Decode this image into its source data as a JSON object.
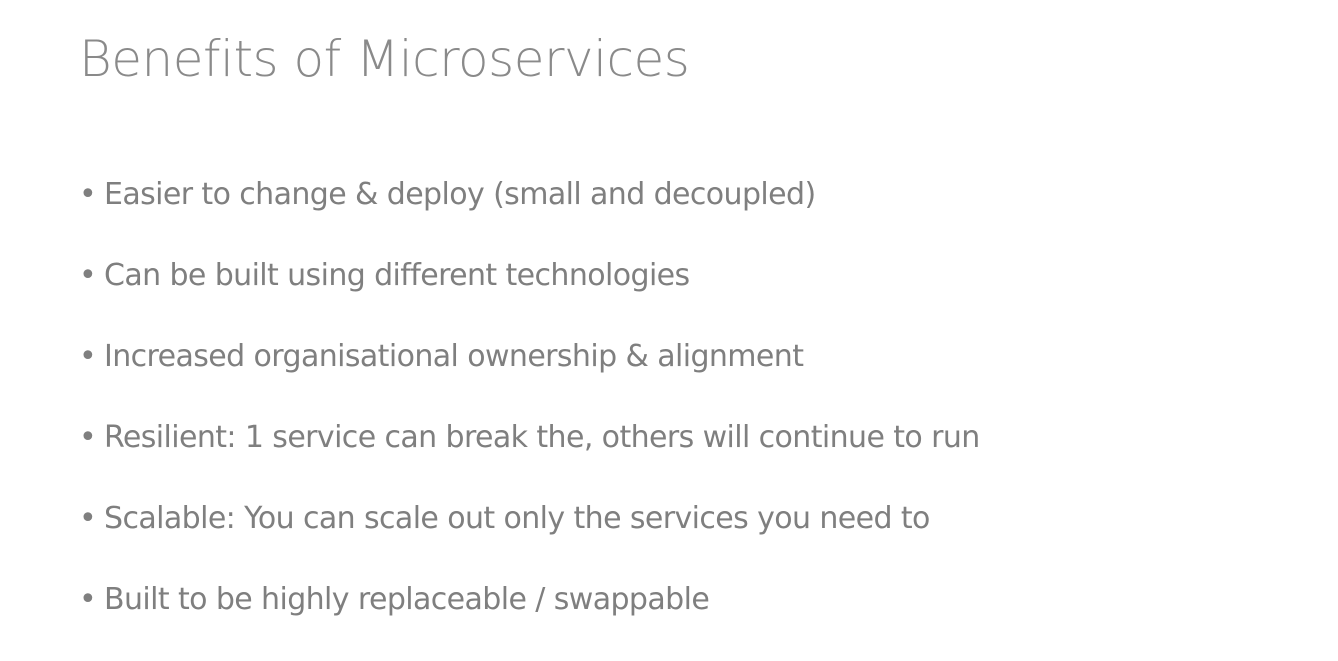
{
  "slide": {
    "title": "Benefits of Microservices",
    "bullet_glyph": "•",
    "bullets": [
      "Easier to change & deploy (small and decoupled)",
      "Can be built using different technologies",
      "Increased organisational ownership & alignment",
      "Resilient: 1 service can break the, others will continue to run",
      "Scalable: You can scale out only the services you need to",
      "Built to be highly replaceable / swappable"
    ]
  },
  "colors": {
    "background": "#ffffff",
    "title_text": "#8a8a8a",
    "body_text": "#7f7f7f"
  }
}
